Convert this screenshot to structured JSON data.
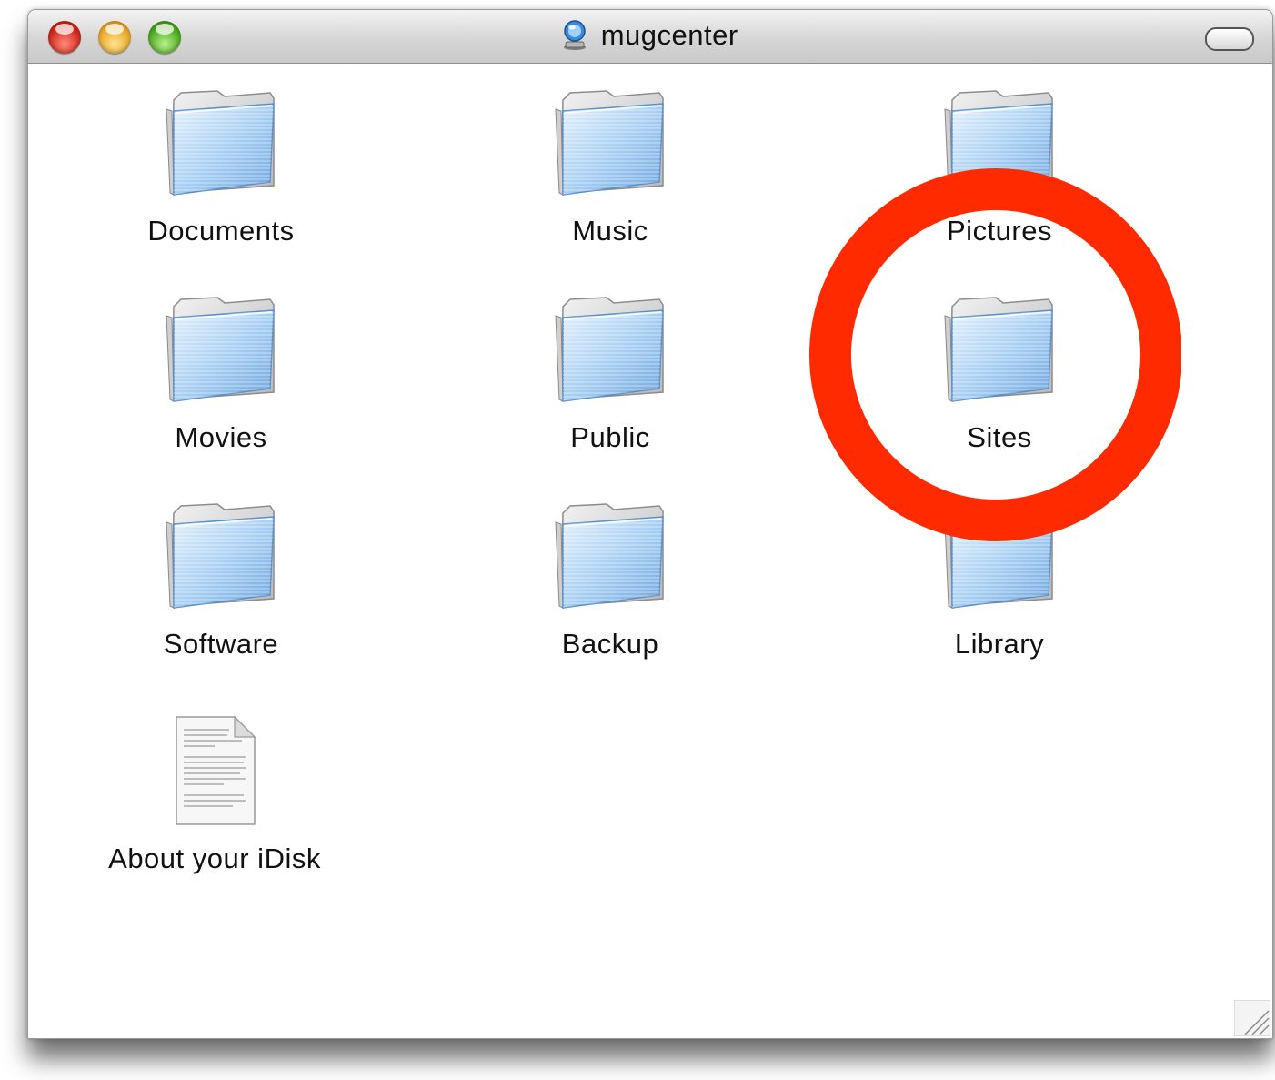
{
  "window": {
    "title": "mugcenter",
    "title_icon": "idisk-icon"
  },
  "items": [
    {
      "label": "Documents",
      "icon": "folder-icon"
    },
    {
      "label": "Music",
      "icon": "folder-icon"
    },
    {
      "label": "Pictures",
      "icon": "folder-icon"
    },
    {
      "label": "Movies",
      "icon": "folder-icon"
    },
    {
      "label": "Public",
      "icon": "folder-icon"
    },
    {
      "label": "Sites",
      "icon": "folder-icon"
    },
    {
      "label": "Software",
      "icon": "folder-icon"
    },
    {
      "label": "Backup",
      "icon": "folder-icon"
    },
    {
      "label": "Library",
      "icon": "folder-icon"
    },
    {
      "label": "About your iDisk",
      "icon": "text-document-icon"
    }
  ],
  "annotation": {
    "shape": "circle",
    "color": "#ff2a00",
    "highlights": "Sites"
  },
  "colors": {
    "close": "#d0261a",
    "minimize": "#e7a62a",
    "zoom": "#4ca820",
    "folder_blue": "#8fc0ee"
  }
}
